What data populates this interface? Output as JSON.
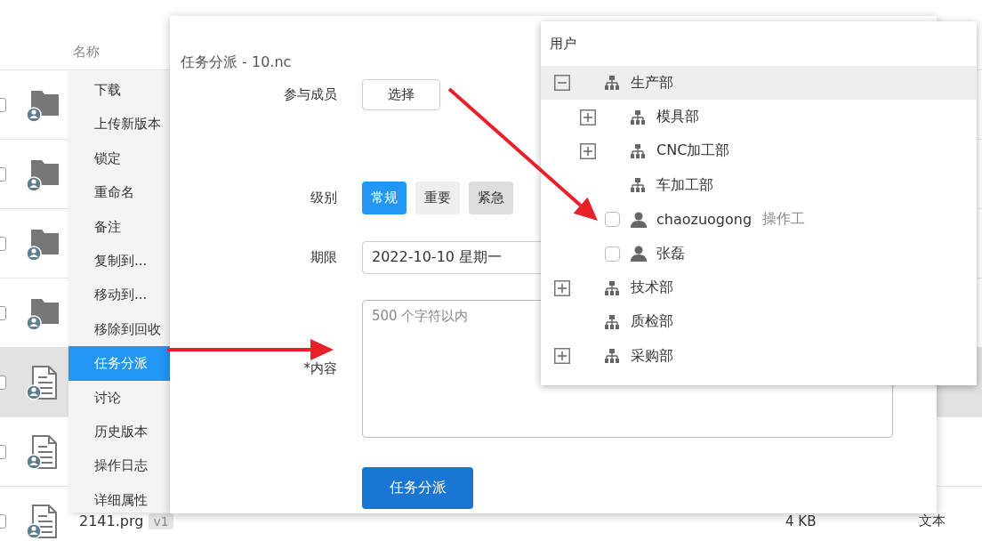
{
  "file_list": {
    "columns": [
      {
        "label": "名称"
      }
    ],
    "rows": [
      {
        "kind": "folder",
        "selected": false
      },
      {
        "kind": "folder",
        "selected": false
      },
      {
        "kind": "folder",
        "selected": false
      },
      {
        "kind": "folder",
        "selected": false
      },
      {
        "kind": "file",
        "selected": true
      },
      {
        "kind": "file",
        "selected": false
      },
      {
        "kind": "file",
        "selected": false,
        "name": "2141.prg",
        "version": "v1",
        "size": "4 KB",
        "type": "文本"
      }
    ]
  },
  "context_menu": {
    "items": [
      {
        "label": "下载",
        "selected": false
      },
      {
        "label": "上传新版本",
        "selected": false
      },
      {
        "label": "锁定",
        "selected": false
      },
      {
        "label": "重命名",
        "selected": false
      },
      {
        "label": "备注",
        "selected": false
      },
      {
        "label": "复制到...",
        "selected": false
      },
      {
        "label": "移动到...",
        "selected": false
      },
      {
        "label": "移除到回收",
        "selected": false
      },
      {
        "label": "任务分派",
        "selected": true
      },
      {
        "label": "讨论",
        "selected": false
      },
      {
        "label": "历史版本",
        "selected": false
      },
      {
        "label": "操作日志",
        "selected": false
      },
      {
        "label": "详细属性",
        "selected": false
      }
    ]
  },
  "dialog": {
    "title": "任务分派 - 10.nc",
    "fields": [
      {
        "kind": "picker",
        "label": "参与成员",
        "button": "选择"
      },
      {
        "kind": "options",
        "label": "级别",
        "options": [
          {
            "label": "常规",
            "selected": true,
            "hovered": false
          },
          {
            "label": "重要",
            "selected": false,
            "hovered": false
          },
          {
            "label": "紧急",
            "selected": false,
            "hovered": true
          }
        ]
      },
      {
        "kind": "date",
        "label": "期限",
        "value": "2022-10-10 星期一"
      },
      {
        "kind": "textarea",
        "label": "*内容",
        "placeholder": "500 个字符以内"
      }
    ],
    "submit": "任务分派"
  },
  "user_picker": {
    "title": "用户",
    "tree": [
      {
        "kind": "dept",
        "label": "生产部",
        "expanded": true,
        "selected": true,
        "children": [
          {
            "kind": "dept",
            "label": "模具部",
            "expanded": false,
            "selected": false
          },
          {
            "kind": "dept",
            "label": "CNC加工部",
            "expanded": false,
            "selected": false
          },
          {
            "kind": "dept",
            "label": "车加工部",
            "selected": false
          },
          {
            "kind": "user",
            "label": "chaozuogong",
            "role": "操作工",
            "checked": false,
            "selected": false
          },
          {
            "kind": "user",
            "label": "张磊",
            "checked": false,
            "selected": false
          }
        ]
      },
      {
        "kind": "dept",
        "label": "技术部",
        "expanded": false,
        "selected": false
      },
      {
        "kind": "dept",
        "label": "质检部",
        "selected": false
      },
      {
        "kind": "dept",
        "label": "采购部",
        "expanded": false,
        "selected": false
      }
    ]
  },
  "annotations": [
    {
      "kind": "arrow"
    },
    {
      "kind": "arrow"
    }
  ]
}
